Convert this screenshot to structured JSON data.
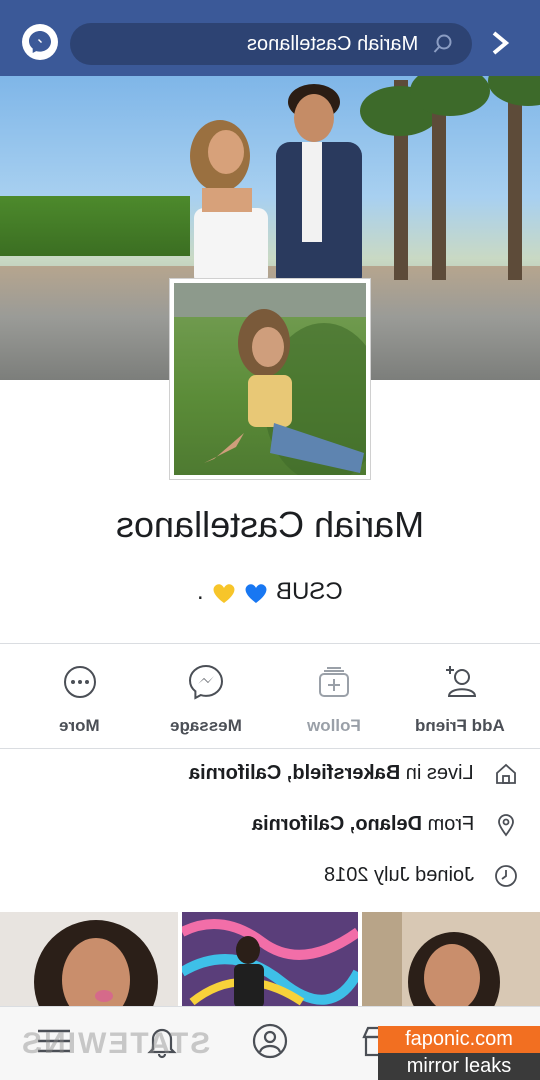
{
  "header": {
    "search_text": "Mariah Castellanos",
    "colors": {
      "bar": "#3b5998",
      "search_bg": "#2d4373"
    }
  },
  "profile": {
    "name": "Mariah Castellanos",
    "bio_text": "CSUB",
    "bio_emoji": [
      "blue-heart",
      "yellow-heart"
    ],
    "bio_suffix": "."
  },
  "actions": [
    {
      "id": "add-friend",
      "label": "Add Friend",
      "icon": "add-friend-icon"
    },
    {
      "id": "follow",
      "label": "Follow",
      "icon": "follow-icon"
    },
    {
      "id": "message",
      "label": "Message",
      "icon": "messenger-icon"
    },
    {
      "id": "more",
      "label": "More",
      "icon": "more-icon"
    }
  ],
  "info": {
    "lives_prefix": "Lives in ",
    "lives_place": "Bakersfield, California",
    "from_prefix": "From ",
    "from_place": "Delano, California",
    "joined": "Joined July 2018"
  },
  "bottom_nav": {
    "watermark": "STATEWINS"
  },
  "badge": {
    "line1": "faponic.com",
    "line2": "mirror leaks"
  }
}
